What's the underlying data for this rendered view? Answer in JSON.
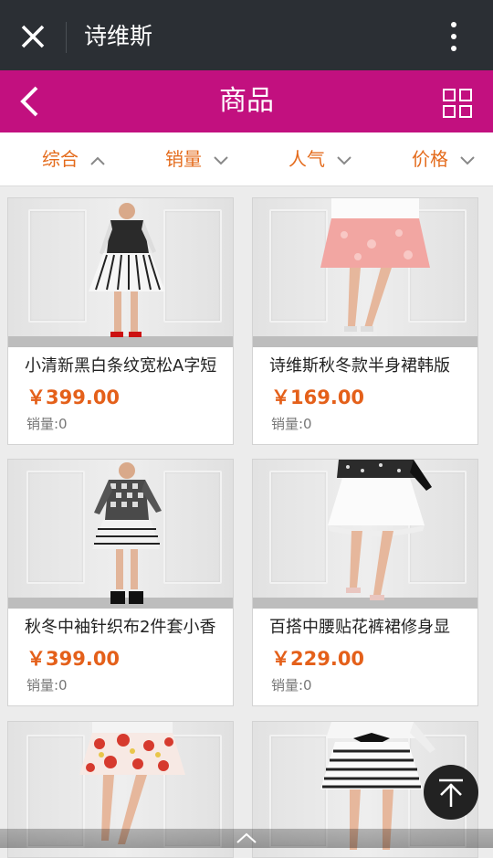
{
  "window": {
    "title": "诗维斯"
  },
  "header": {
    "title": "商品"
  },
  "sort_tabs": [
    {
      "label": "综合",
      "direction": "up"
    },
    {
      "label": "销量",
      "direction": "down"
    },
    {
      "label": "人气",
      "direction": "down"
    },
    {
      "label": "价格",
      "direction": "down"
    }
  ],
  "products": [
    {
      "name": "小清新黑白条纹宽松A字短",
      "price": "￥399.00",
      "sales": "销量:0"
    },
    {
      "name": "诗维斯秋冬款半身裙韩版",
      "price": "￥169.00",
      "sales": "销量:0"
    },
    {
      "name": "秋冬中袖针织布2件套小香",
      "price": "￥399.00",
      "sales": "销量:0"
    },
    {
      "name": "百搭中腰贴花裤裙修身显",
      "price": "￥229.00",
      "sales": "销量:0"
    }
  ],
  "colors": {
    "topbar": "#2b2f34",
    "accent": "#c2107f",
    "sort": "#e46b1c",
    "price": "#e4601a"
  }
}
